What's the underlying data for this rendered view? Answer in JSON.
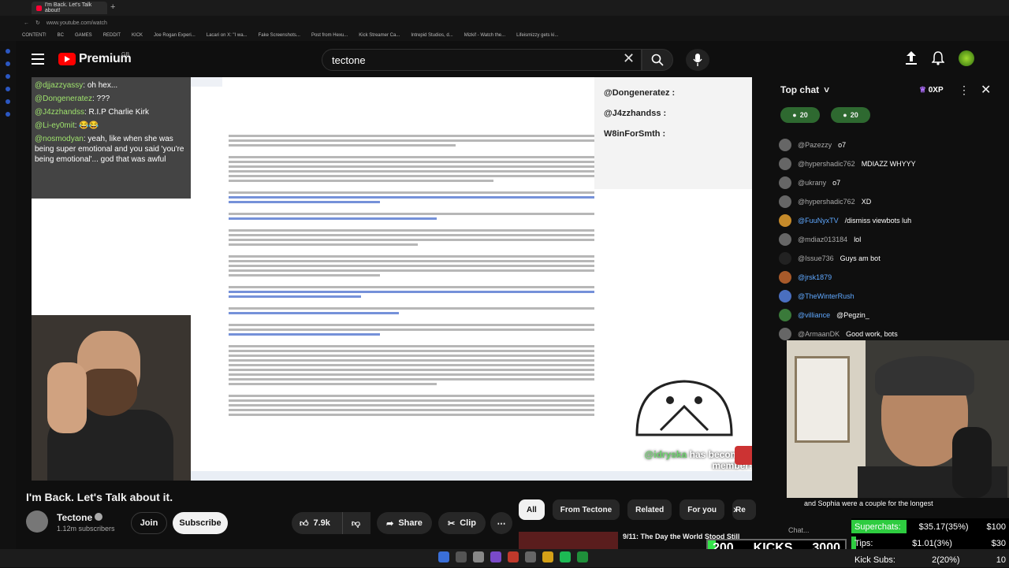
{
  "browser": {
    "tab_title": "I'm Back. Let's Talk about!",
    "url": "www.youtube.com/watch",
    "bookmarks": [
      "CONTENT!",
      "BC",
      "GAMES",
      "REDDIT",
      "KICK",
      "Joe Rogan Experi...",
      "Lacari on X: \"I wa...",
      "Fake Screenshots...",
      "Post from Hexu...",
      "Kick Streamer Ca...",
      "Intrepid Studios, d...",
      "Mizkif - Watch the...",
      "Lifeismizzy gets ki..."
    ]
  },
  "header": {
    "brand": "Premium",
    "region": "GB",
    "search_value": "tectone"
  },
  "video": {
    "chat_overlay": [
      {
        "user": "@djjazzyassy",
        "text": ": oh hex..."
      },
      {
        "user": "@Dongeneratez",
        "text": ": ???"
      },
      {
        "user": "@J4zzhandss",
        "text": ": R.I.P Charlie Kirk"
      },
      {
        "user": "@Li-ey0mit",
        "text": ": 😂😂"
      },
      {
        "user": "@nosmodyan",
        "text": ": yeah, like when she was being super emotional and you said 'you're being emotional'... god that was awful"
      }
    ],
    "names_panel": [
      "@Dongeneratez :",
      "@J4zzhandss :",
      "W8inForSmth :"
    ],
    "member_user": "@idryska",
    "member_text": "has become a member!"
  },
  "below_video": {
    "title": "I'm Back. Let's Talk about it.",
    "channel": "Tectone",
    "subscribers": "1.12m subscribers",
    "join_label": "Join",
    "subscribe_label": "Subscribe",
    "likes": "7.9k",
    "share_label": "Share",
    "clip_label": "Clip"
  },
  "filters": {
    "chips": [
      "All",
      "From Tectone",
      "Related",
      "For you",
      "Re"
    ],
    "next_title": "9/11: The Day the World Stood Still"
  },
  "chat": {
    "title": "Top chat",
    "xp": "0XP",
    "badges": [
      "20",
      "20"
    ],
    "messages": [
      {
        "author": "@Pazezzy",
        "text": "o7",
        "blue": false
      },
      {
        "author": "@hypershadic762",
        "text": "MDIAZZ WHYYY",
        "blue": false
      },
      {
        "author": "@ukrany",
        "text": "o7",
        "blue": false
      },
      {
        "author": "@hypershadic762",
        "text": "XD",
        "blue": false
      },
      {
        "author": "@FuuNyxTV",
        "text": "/dismiss viewbots luh",
        "blue": true
      },
      {
        "author": "@mdiaz013184",
        "text": "lol",
        "blue": false
      },
      {
        "author": "@Issue736",
        "text": "Guys am bot",
        "blue": false
      },
      {
        "author": "@jrsk1879",
        "text": "",
        "blue": true
      },
      {
        "author": "@TheWinterRush",
        "text": "",
        "blue": true
      },
      {
        "author": "@villiance",
        "text": "@Pegzin_",
        "blue": true
      },
      {
        "author": "@ArmaanDK",
        "text": "Good work, bots",
        "blue": false
      }
    ],
    "caption": "and Sophia were a couple for the longest",
    "input_placeholder": "Chat..."
  },
  "overlay": {
    "kicks_left": "200",
    "kicks_label": "KICKS",
    "kicks_right": "3000",
    "stats": [
      {
        "label": "Superchats:",
        "value": "$35.17(35%)",
        "goal": "$100",
        "pct": 35
      },
      {
        "label": "Tips:",
        "value": "$1.01(3%)",
        "goal": "$30",
        "pct": 3
      },
      {
        "label": "Kick Subs:",
        "value": "2(20%)",
        "goal": "10",
        "pct": 20
      }
    ]
  },
  "colors": {
    "accent": "#ff0000",
    "member_green": "#6fd46f",
    "kick_green": "#2ecc40"
  }
}
